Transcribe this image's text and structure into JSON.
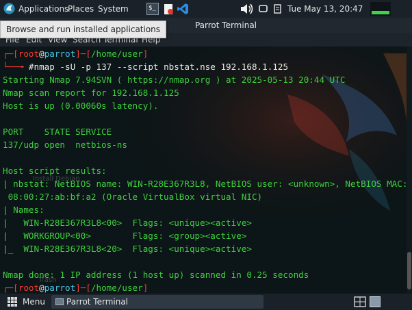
{
  "top_panel": {
    "applications": "Applications",
    "places": "Places",
    "system": "System",
    "terminal_launcher_glyph": "$_",
    "clock": "Tue May 13, 20:47"
  },
  "tooltip": "Browse and run installed applications",
  "window": {
    "title": "Parrot Terminal",
    "menu": {
      "file": "File",
      "edit": "Edit",
      "view": "View",
      "search": "Search",
      "terminal": "Terminal",
      "help": "Help"
    }
  },
  "desktop": {
    "install_label": "Install Debian",
    "trash_label": "Trash"
  },
  "terminal": {
    "prompt1": {
      "open": "┌─[",
      "user": "root",
      "at": "@",
      "host": "parrot",
      "sep": "]─[",
      "path": "/home/user",
      "close": "]"
    },
    "prompt_arrow": "└──╼ ",
    "prompt_hash": "#",
    "command": "nmap -sU -p 137 --script nbstat.nse 192.168.1.125",
    "output": [
      "Starting Nmap 7.94SVN ( https://nmap.org ) at 2025-05-13 20:44 UTC",
      "Nmap scan report for 192.168.1.125",
      "Host is up (0.00060s latency).",
      "",
      "PORT    STATE SERVICE",
      "137/udp open  netbios-ns",
      "",
      "Host script results:",
      "| nbstat: NetBIOS name: WIN-R28E367R3L8, NetBIOS user: <unknown>, NetBIOS MAC:",
      " 08:00:27:ab:bf:a2 (Oracle VirtualBox virtual NIC)",
      "| Names:",
      "|   WIN-R28E367R3L8<00>  Flags: <unique><active>",
      "|   WORKGROUP<00>        Flags: <group><active>",
      "|_  WIN-R28E367R3L8<20>  Flags: <unique><active>",
      "",
      "Nmap done: 1 IP address (1 host up) scanned in 0.25 seconds"
    ],
    "prompt2": {
      "open": "┌─[",
      "user": "root",
      "at": "@",
      "host": "parrot",
      "sep": "]─[",
      "path": "/home/user",
      "close": "]"
    }
  },
  "bottom_panel": {
    "menu_label": "Menu",
    "task_label": "Parrot Terminal"
  },
  "colors": {
    "terminal_green": "#3ed13e",
    "prompt_red": "#ff3b30",
    "prompt_cyan": "#49c6e8",
    "panel": "#1b2128"
  }
}
